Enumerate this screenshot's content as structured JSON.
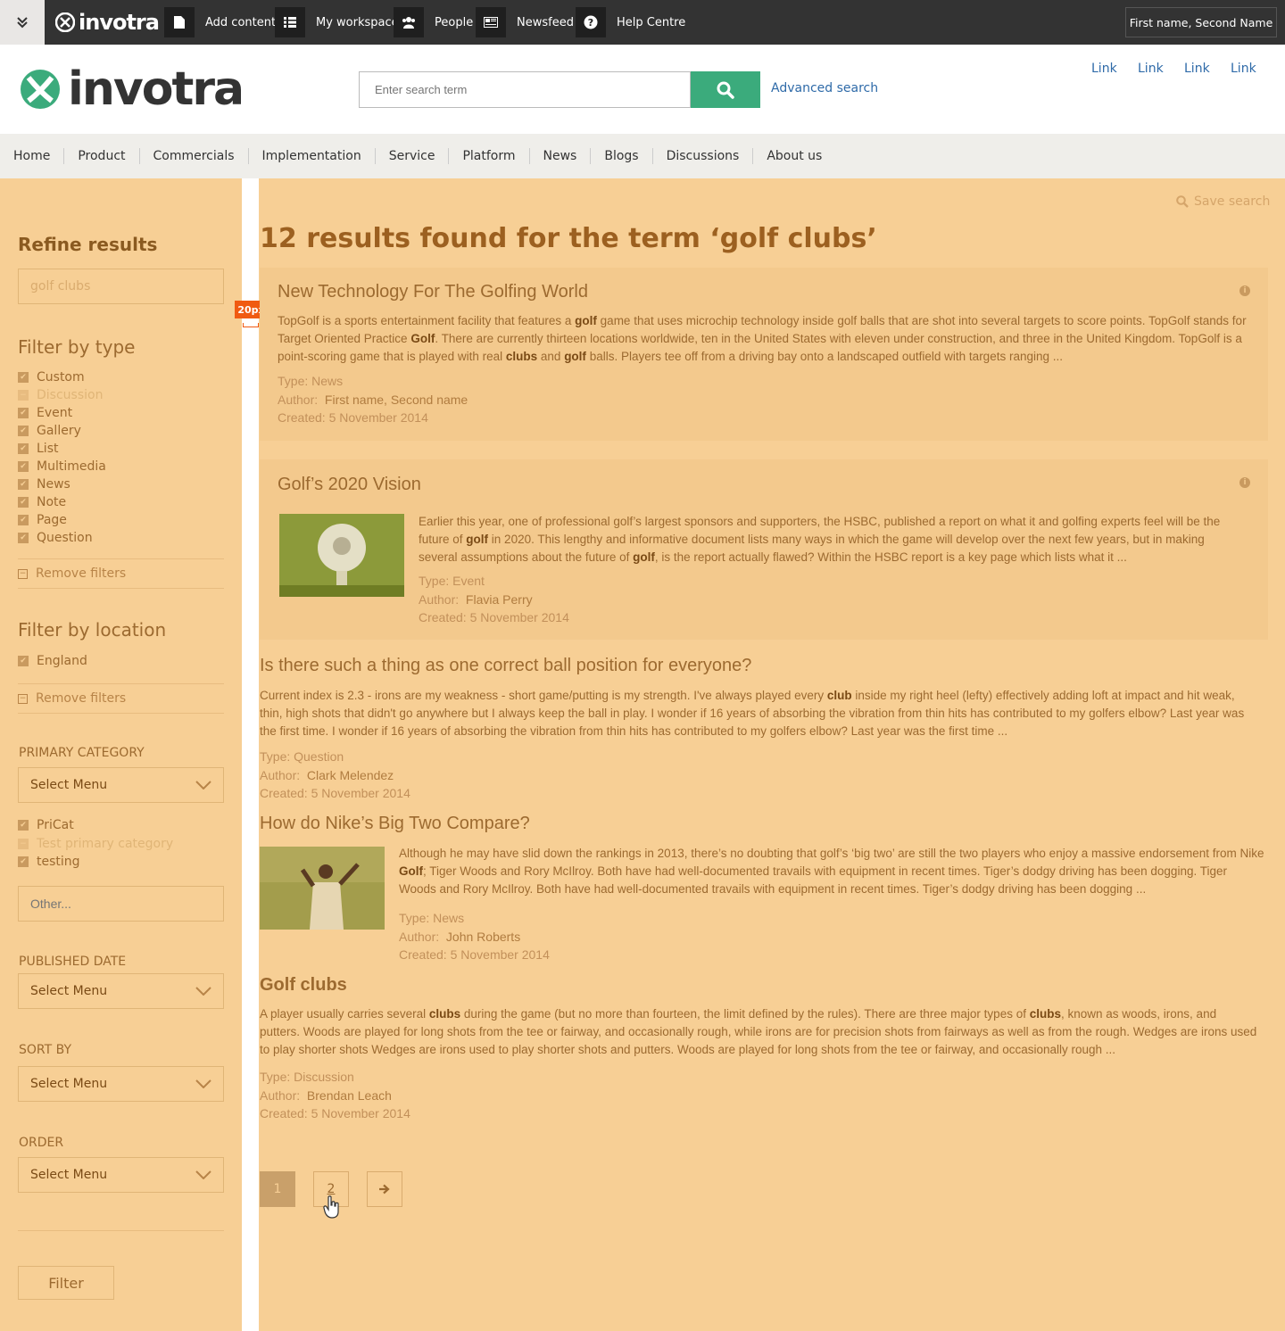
{
  "topbar": {
    "logo_text": "invotra",
    "items": [
      {
        "label": "Add content",
        "icon": "file-icon"
      },
      {
        "label": "My workspace",
        "icon": "list-icon"
      },
      {
        "label": "People",
        "icon": "people-icon"
      },
      {
        "label": "Newsfeed",
        "icon": "newspaper-icon"
      },
      {
        "label": "Help Centre",
        "icon": "question-icon"
      }
    ],
    "user_name": "First name, Second Name"
  },
  "header": {
    "logo_text": "invotra",
    "search_placeholder": "Enter search term",
    "advanced_search": "Advanced search",
    "links": [
      "Link",
      "Link",
      "Link",
      "Link"
    ]
  },
  "nav": [
    "Home",
    "Product",
    "Commercials",
    "Implementation",
    "Service",
    "Platform",
    "News",
    "Blogs",
    "Discussions",
    "About us"
  ],
  "spacing_badge": "20px",
  "sidebar": {
    "refine_title": "Refine results",
    "search_value": "golf clubs",
    "filter_type_title": "Filter by type",
    "types": [
      {
        "label": "Custom",
        "checked": true
      },
      {
        "label": "Discussion",
        "checked": false
      },
      {
        "label": "Event",
        "checked": true
      },
      {
        "label": "Gallery",
        "checked": true
      },
      {
        "label": "List",
        "checked": true
      },
      {
        "label": "Multimedia",
        "checked": true
      },
      {
        "label": "News",
        "checked": true
      },
      {
        "label": "Note",
        "checked": true
      },
      {
        "label": "Page",
        "checked": true
      },
      {
        "label": "Question",
        "checked": true
      }
    ],
    "remove_filters": "Remove filters",
    "filter_location_title": "Filter by location",
    "locations": [
      {
        "label": "England",
        "checked": true
      }
    ],
    "primary_category_label": "PRIMARY CATEGORY",
    "select_menu": "Select Menu",
    "categories": [
      {
        "label": "PriCat",
        "checked": true
      },
      {
        "label": "Test primary category",
        "checked": false
      },
      {
        "label": "testing",
        "checked": true
      }
    ],
    "other_placeholder": "Other...",
    "published_date_label": "PUBLISHED DATE",
    "sort_by_label": "SORT BY",
    "order_label": "ORDER",
    "filter_button": "Filter"
  },
  "main": {
    "save_search": "Save search",
    "title": "12 results found for the term ‘golf clubs’",
    "results": [
      {
        "title": "New Technology For The Golfing World",
        "excerpt_html": "TopGolf is a sports entertainment facility that features a <b>golf</b> game that uses microchip technology inside golf balls that are shot into several targets to score points. TopGolf stands for Target Oriented Practice <b>Golf</b>. There are currently thirteen locations worldwide, ten in the United States with eleven under construction, and three in the United Kingdom. TopGolf is a point-scoring game that is played with real <b>clubs</b> and <b>golf</b> balls. Players tee off from a driving bay onto a landscaped outfield with targets ranging ...",
        "type": "Type: News",
        "author_label": "Author:",
        "author": "First name, Second name",
        "created": "Created: 5 November 2014"
      },
      {
        "title": "Golf’s 2020 Vision",
        "excerpt_html": "Earlier this year, one of professional golf’s largest sponsors and supporters, the HSBC, published a report on what it and golfing experts feel will be the future of <b>golf</b> in 2020. This lengthy and informative document lists many ways in which the game will develop over the next few years, but in making several assumptions about the future of <b>golf</b>, is the report actually flawed? Within the HSBC report is a key page which lists what it ...",
        "type": "Type: Event",
        "author_label": "Author:",
        "author": "Flavia Perry",
        "created": "Created: 5 November 2014"
      },
      {
        "title": "Is there such a thing as one correct ball position for everyone?",
        "excerpt_html": "Current index is 2.3 - irons are my weakness - short game/putting is my strength. I've always played every <b>club</b> inside my right heel (lefty) effectively adding loft at impact and hit weak, thin, high shots that didn't go anywhere but I always keep the ball in play.  I wonder if 16 years of absorbing the vibration from thin hits has contributed to my golfers elbow? Last year was the first time.  I wonder if 16 years of absorbing the vibration from thin hits has contributed to my golfers elbow?  Last year was the first time ...",
        "type": "Type: Question",
        "author_label": "Author:",
        "author": "Clark Melendez",
        "created": "Created: 5 November 2014"
      },
      {
        "title": "How do Nike’s Big Two Compare?",
        "excerpt_html": "Although he may have slid down the rankings in 2013, there’s no doubting that golf’s ‘big two’  are still the two players who enjoy a massive endorsement from Nike <b>Golf</b>; Tiger Woods and Rory McIlroy. Both have had well-documented travails with equipment in recent times. Tiger’s dodgy driving has been dogging. Tiger Woods and Rory McIlroy. Both have had well-documented travails with equipment in recent times. Tiger’s dodgy driving has been dogging ...",
        "type": "Type: News",
        "author_label": "Author:",
        "author": "John Roberts",
        "created": "Created: 5 November 2014"
      },
      {
        "title": "Golf clubs",
        "excerpt_html": "A player usually carries several <b>clubs</b> during the game (but no more than fourteen, the limit defined by the rules). There are three major types of <b>clubs</b>, known as woods, irons, and putters. Woods are played for long shots from the tee or fairway, and occasionally rough, while irons are for precision shots from fairways as well as from the rough.  Wedges are irons used to play shorter shots Wedges are irons used to play shorter shots and putters. Woods are played for long shots from the tee or fairway, and occasionally rough ...",
        "type": "Type: Discussion",
        "author_label": "Author:",
        "author": "Brendan Leach",
        "created": "Created: 5 November 2014"
      }
    ],
    "pagination": {
      "current": "1",
      "next_page": "2",
      "next_icon": "arrow-right-icon"
    }
  },
  "colors": {
    "accent": "#3bab7c",
    "link": "#2e6aa8",
    "overlay": "#f7cf95",
    "badge": "#f05a12"
  }
}
